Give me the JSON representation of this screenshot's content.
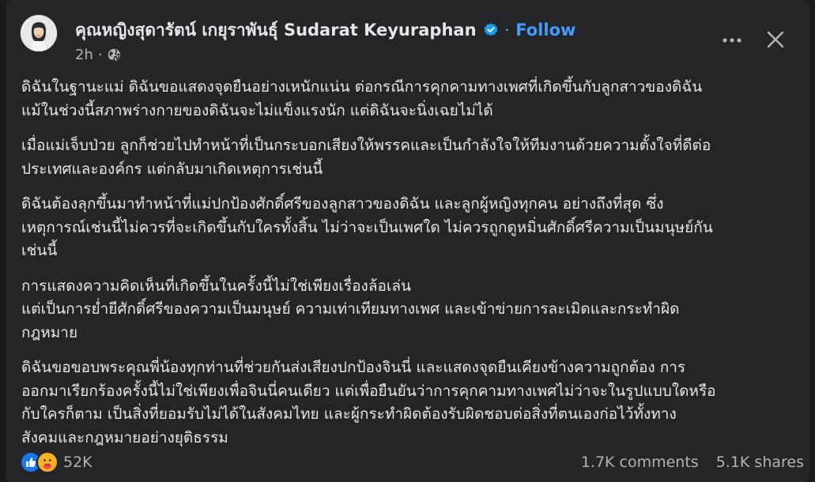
{
  "post": {
    "author": "คุณหญิงสุดารัตน์ เกยุราพันธุ์ Sudarat Keyuraphan",
    "separator": "·",
    "follow_label": "Follow",
    "time": "2h",
    "paragraphs": [
      [
        "ดิฉันในฐานะแม่ ดิฉันขอแสดงจุดยืนอย่างเหนักแน่น ต่อกรณีการคุกคามทางเพศที่เกิดขึ้นกับลูกสาวของดิฉัน",
        "แม้ในช่วงนี้สภาพร่างกายของดิฉันจะไม่แข็งแรงนัก แต่ดิฉันจะนิ่งเฉยไม่ได้"
      ],
      [
        "เมื่อแม่เจ็บป่วย ลูกก็ช่วยไปทำหน้าที่เป็นกระบอกเสียงให้พรรคและเป็นกำลังใจให้ทีมงานด้วยความตั้งใจที่ดีต่อ",
        "ประเทศและองค์กร แต่กลับมาเกิดเหตุการเช่นนี้"
      ],
      [
        "ดิฉันต้องลุกขึ้นมาทำหน้าที่แม่ปกป้องศักดิ์ศรีของลูกสาวของดิฉัน และลูกผู้หญิงทุกคน อย่างถึงที่สุด ซึ่ง",
        "เหตุการณ์เช่นนี้ไม่ควรที่จะเกิดขึ้นกับใครทั้งสิ้น ไม่ว่าจะเป็นเพศใด ไม่ควรถูกดูหมิ่นศักดิ์ศรีความเป็นมนุษย์กัน",
        "เช่นนี้"
      ],
      [
        "การแสดงความคิดเห็นที่เกิดขึ้นในครั้งนี้ไม่ใช่เพียงเรื่องล้อเล่น",
        "แต่เป็นการย่ำยีศักดิ์ศรีของความเป็นมนุษย์ ความเท่าเทียมทางเพศ และเข้าข่ายการละเมิดและกระทำผิด",
        "กฎหมาย"
      ],
      [
        "ดิฉันขอขอบพระคุณพี่น้องทุกท่านที่ช่วยกันส่งเสียงปกป้องจินนี่ และแสดงจุดยืนเคียงข้างความถูกต้อง การ",
        "ออกมาเรียกร้องครั้งนี้ไม่ใช่เพียงเพื่อจินนี่คนเดียว แต่เพื่อยืนยันว่าการคุกคามทางเพศไม่ว่าจะในรูปแบบใดหรือ",
        "กับใครก็ตาม เป็นสิ่งที่ยอมรับไม่ได้ในสังคมไทย และผู้กระทำผิดต้องรับผิดชอบต่อสิ่งที่ตนเองก่อไว้ทั้งทาง",
        "สังคมและกฎหมายอย่างยุติธรรม"
      ]
    ],
    "reaction_count": "52K",
    "comments": "1.7K comments",
    "shares": "5.1K shares"
  },
  "icons": {
    "avatar": "profile-photo",
    "verified": "verified-badge-icon",
    "audience": "globe-icon",
    "more": "more-dots-icon",
    "close": "close-icon",
    "reactions": [
      "like-icon",
      "care-icon"
    ]
  },
  "colors": {
    "page_bg": "#18191a",
    "card_bg": "#242526",
    "text_primary": "#e4e6eb",
    "text_secondary": "#b0b3b8",
    "link_blue": "#4599ff",
    "like_blue": "#1877f2",
    "care_yellow": "#f7b125"
  }
}
